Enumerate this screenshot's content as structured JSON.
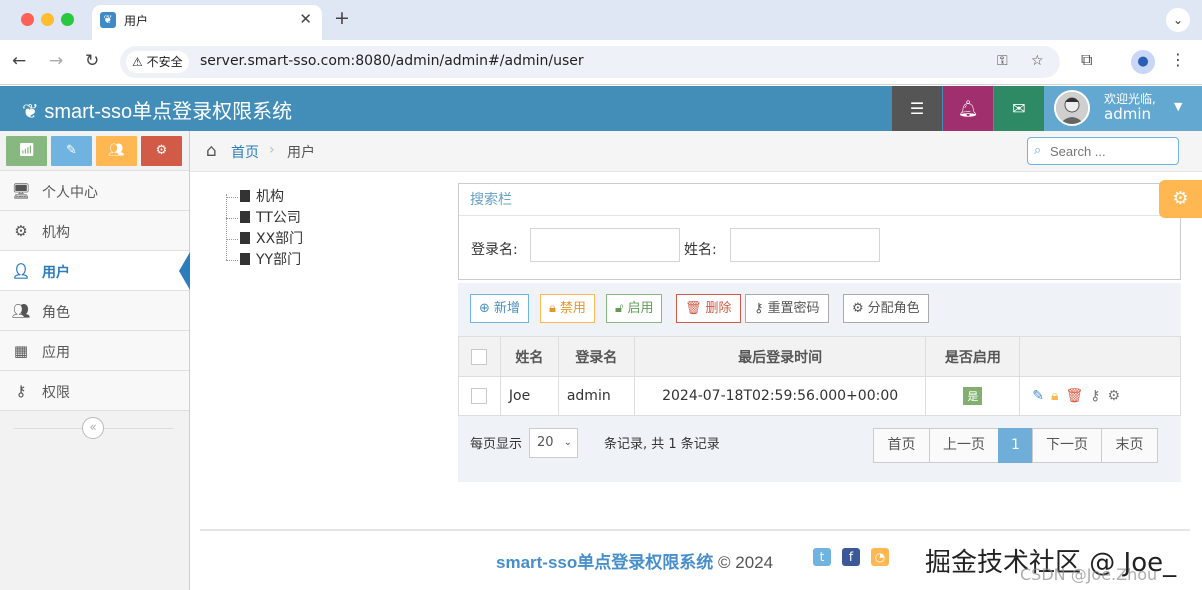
{
  "browser": {
    "tab_title": "用户",
    "security_label": "不安全",
    "url": "server.smart-sso.com:8080/admin/admin#/admin/user"
  },
  "header": {
    "brand": "smart-sso单点登录权限系统",
    "welcome": "欢迎光临,",
    "username": "admin",
    "colors": {
      "header_bg": "#438eb9",
      "tasks": "#555555",
      "notifications": "#a0306d",
      "messages": "#2e8965",
      "user": "#62a8d1"
    }
  },
  "sidebar": {
    "shortcut_colors": [
      "#87b87f",
      "#6fb3e0",
      "#ffb752",
      "#d15b47"
    ],
    "items": [
      {
        "label": "个人中心",
        "icon": "desktop-icon"
      },
      {
        "label": "机构",
        "icon": "cogs-icon"
      },
      {
        "label": "用户",
        "icon": "user-icon",
        "active": true
      },
      {
        "label": "角色",
        "icon": "users-icon"
      },
      {
        "label": "应用",
        "icon": "grid-icon"
      },
      {
        "label": "权限",
        "icon": "key-icon"
      }
    ]
  },
  "breadcrumb": {
    "home": "首页",
    "current": "用户"
  },
  "search": {
    "placeholder": "Search ..."
  },
  "tree": {
    "root": "机构",
    "children": [
      "TT公司",
      "XX部门",
      "YY部门"
    ]
  },
  "filter": {
    "title": "搜索栏",
    "login_label": "登录名:",
    "name_label": "姓名:"
  },
  "actions": {
    "add": "新增",
    "disable": "禁用",
    "enable": "启用",
    "delete": "删除",
    "reset_password": "重置密码",
    "assign_role": "分配角色"
  },
  "table": {
    "headers": [
      "",
      "姓名",
      "登录名",
      "最后登录时间",
      "是否启用",
      ""
    ],
    "rows": [
      {
        "name": "Joe",
        "login": "admin",
        "last_login": "2024-07-18T02:59:56.000+00:00",
        "enabled": "是"
      }
    ]
  },
  "pager": {
    "per_page_label": "每页显示",
    "page_size": "20",
    "summary": "条记录, 共 1 条记录",
    "first": "首页",
    "prev": "上一页",
    "current": "1",
    "next": "下一页",
    "last": "末页"
  },
  "footer": {
    "brand": "smart-sso单点登录权限系统",
    "copyright": "© 2024"
  },
  "watermark": {
    "main": "掘金技术社区 @ Joe_",
    "sub": "CSDN @Joe.Zhou"
  }
}
